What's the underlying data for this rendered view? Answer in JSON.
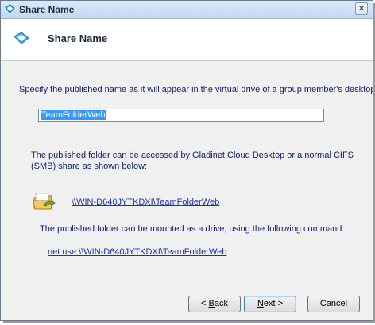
{
  "window": {
    "title": "Share Name",
    "close_glyph": "✕"
  },
  "header": {
    "title": "Share Name",
    "icon": "share-name-icon"
  },
  "content": {
    "intro": "Specify the published name as it will appear in the virtual drive of a group member's desktop.",
    "share_name_value": "TeamFolderWeb",
    "access_text": "The published folder can be accessed by Gladinet Cloud Desktop or a normal CIFS (SMB) share as shown below:",
    "share_path": "\\\\WIN-D640JYTKDXI\\TeamFolderWeb",
    "mount_text": "The published folder can be mounted as a drive, using the following command:",
    "net_use_command": "net use \\\\WIN-D640JYTKDXI\\TeamFolderWeb"
  },
  "buttons": {
    "back": {
      "prefix": "< ",
      "accel": "B",
      "rest": "ack"
    },
    "next": {
      "accel": "N",
      "rest": "ext >"
    },
    "cancel": "Cancel"
  }
}
